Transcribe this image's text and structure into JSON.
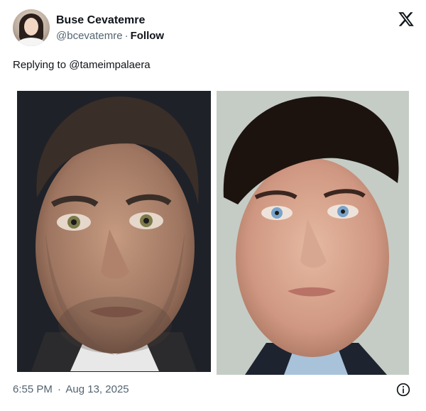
{
  "tweet": {
    "author_name": "Buse Cevatemre",
    "author_handle": "@bcevatemre",
    "separator": "·",
    "follow_label": "Follow",
    "replying_to": "Replying to @tameimpalaera",
    "time": "6:55 PM",
    "date": "Aug 13, 2025"
  },
  "icons": {
    "brand": "x-logo-icon",
    "info": "info-icon"
  },
  "colors": {
    "text_primary": "#0f1419",
    "text_secondary": "#536471"
  }
}
